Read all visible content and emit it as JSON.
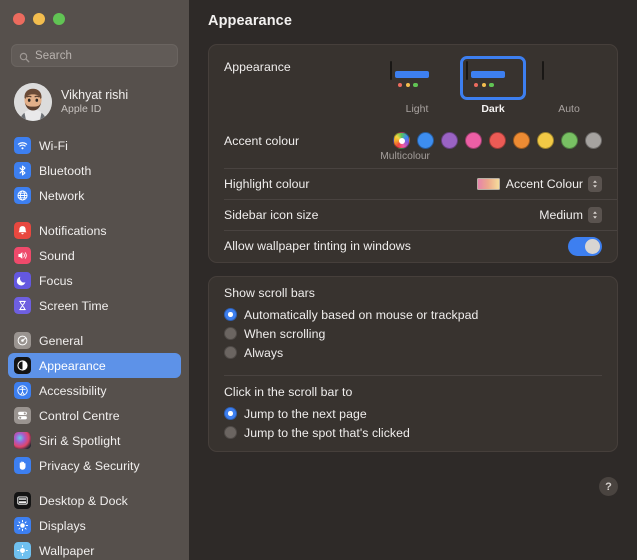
{
  "window": {
    "traffic_lights": [
      {
        "name": "close",
        "color": "#ec6b5e"
      },
      {
        "name": "minimize",
        "color": "#f3bd4e"
      },
      {
        "name": "maximize",
        "color": "#61c454"
      }
    ]
  },
  "sidebar": {
    "search": {
      "placeholder": "Search",
      "value": "",
      "icon": "search-icon"
    },
    "account": {
      "name": "Vikhyat rishi",
      "subtitle": "Apple ID",
      "avatar": "memoji-avatar"
    },
    "groups": [
      {
        "items": [
          {
            "label": "Wi-Fi",
            "icon": "wifi-icon",
            "color": "#3d7ff0",
            "selected": false
          },
          {
            "label": "Bluetooth",
            "icon": "bluetooth-icon",
            "color": "#3d7ff0",
            "selected": false
          },
          {
            "label": "Network",
            "icon": "globe-icon",
            "color": "#3d7ff0",
            "selected": false
          }
        ]
      },
      {
        "items": [
          {
            "label": "Notifications",
            "icon": "bell-icon",
            "color": "#e8483f",
            "selected": false
          },
          {
            "label": "Sound",
            "icon": "speaker-icon",
            "color": "#ef4a6b",
            "selected": false
          },
          {
            "label": "Focus",
            "icon": "moon-icon",
            "color": "#6458e0",
            "selected": false
          },
          {
            "label": "Screen Time",
            "icon": "hourglass-icon",
            "color": "#6e5fe0",
            "selected": false
          }
        ]
      },
      {
        "items": [
          {
            "label": "General",
            "icon": "gear-icon",
            "color": "#9a9490",
            "selected": false
          },
          {
            "label": "Appearance",
            "icon": "appearance-icon",
            "color": "#1b1b1b",
            "selected": true
          },
          {
            "label": "Accessibility",
            "icon": "accessibility-icon",
            "color": "#3d7ff0",
            "selected": false
          },
          {
            "label": "Control Centre",
            "icon": "control-centre-icon",
            "color": "#9a9490",
            "selected": false
          },
          {
            "label": "Siri & Spotlight",
            "icon": "siri-icon",
            "color": "#2b2b35",
            "selected": false
          },
          {
            "label": "Privacy & Security",
            "icon": "hand-icon",
            "color": "#3d7ff0",
            "selected": false
          }
        ]
      },
      {
        "items": [
          {
            "label": "Desktop & Dock",
            "icon": "desktop-dock-icon",
            "color": "#1b1b1b",
            "selected": false
          },
          {
            "label": "Displays",
            "icon": "brightness-icon",
            "color": "#3d7ff0",
            "selected": false
          },
          {
            "label": "Wallpaper",
            "icon": "wallpaper-icon",
            "color": "#6fc0ef",
            "selected": false
          }
        ]
      }
    ]
  },
  "main": {
    "title": "Appearance",
    "appearance": {
      "label": "Appearance",
      "options": [
        {
          "name": "Light",
          "selected": false
        },
        {
          "name": "Dark",
          "selected": true
        },
        {
          "name": "Auto",
          "selected": false
        }
      ]
    },
    "accent": {
      "label": "Accent colour",
      "caption": "Multicolour",
      "swatches": [
        {
          "name": "Multicolour",
          "color": "multicolour",
          "selected": false
        },
        {
          "name": "Blue",
          "color": "#3d8ef0",
          "selected": false
        },
        {
          "name": "Purple",
          "color": "#9a63c4",
          "selected": false
        },
        {
          "name": "Pink",
          "color": "#ec5fa5",
          "selected": false
        },
        {
          "name": "Red",
          "color": "#ec5b55",
          "selected": false
        },
        {
          "name": "Orange",
          "color": "#ed8b33",
          "selected": false
        },
        {
          "name": "Yellow",
          "color": "#f2c945",
          "selected": false
        },
        {
          "name": "Green",
          "color": "#78c063",
          "selected": false
        },
        {
          "name": "Graphite",
          "color": "#a6a3a0",
          "selected": false
        }
      ]
    },
    "highlight": {
      "label": "Highlight colour",
      "value": "Accent Colour"
    },
    "sidebar_icon_size": {
      "label": "Sidebar icon size",
      "value": "Medium"
    },
    "wallpaper_tinting": {
      "label": "Allow wallpaper tinting in windows",
      "enabled": true
    },
    "scroll_bars": {
      "title": "Show scroll bars",
      "options": [
        {
          "label": "Automatically based on mouse or trackpad",
          "selected": true
        },
        {
          "label": "When scrolling",
          "selected": false
        },
        {
          "label": "Always",
          "selected": false
        }
      ]
    },
    "scroll_click": {
      "title": "Click in the scroll bar to",
      "options": [
        {
          "label": "Jump to the next page",
          "selected": true
        },
        {
          "label": "Jump to the spot that's clicked",
          "selected": false
        }
      ]
    },
    "help": {
      "label": "?"
    }
  }
}
